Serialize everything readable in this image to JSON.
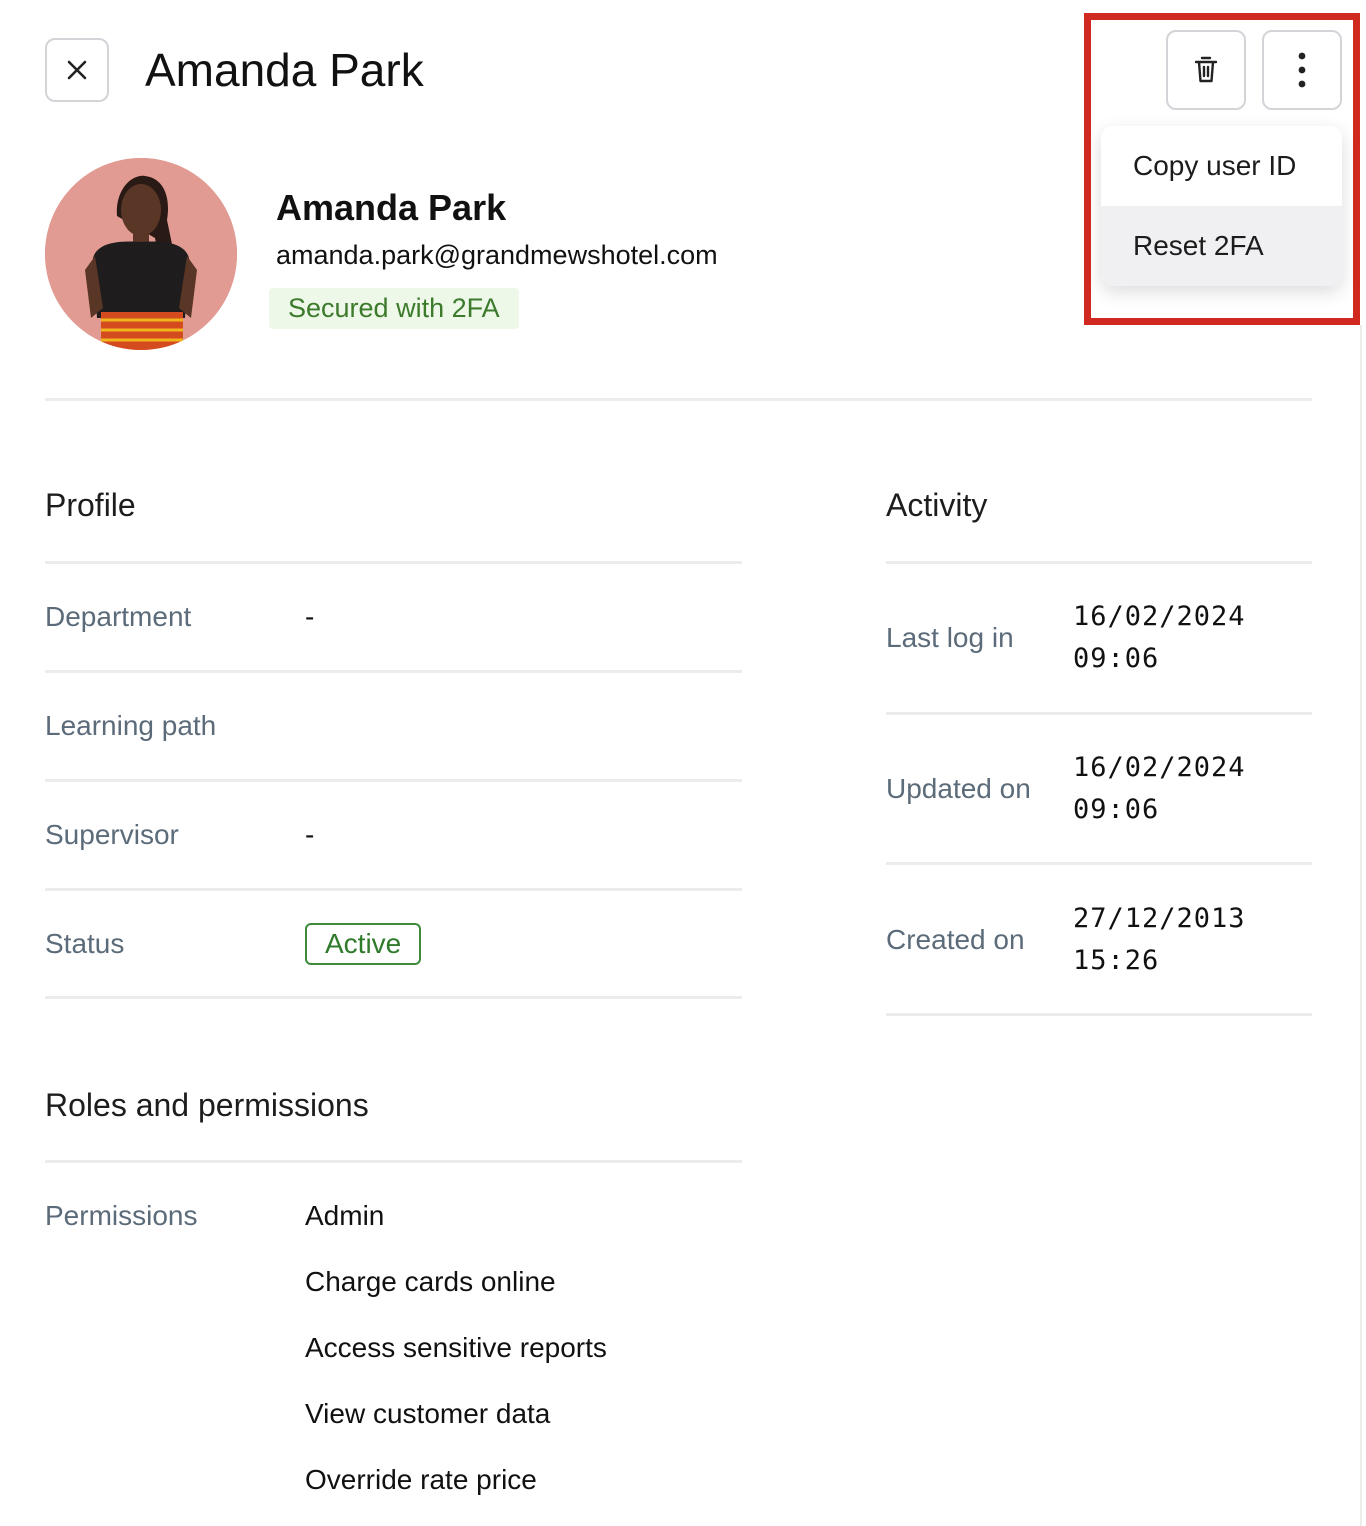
{
  "header": {
    "title": "Amanda Park"
  },
  "actions_menu": {
    "items": [
      {
        "label": "Copy user ID"
      },
      {
        "label": "Reset 2FA"
      }
    ]
  },
  "user": {
    "name": "Amanda Park",
    "email": "amanda.park@grandmewshotel.com",
    "security_badge": "Secured with 2FA"
  },
  "profile": {
    "title": "Profile",
    "rows": [
      {
        "label": "Department",
        "value": "-"
      },
      {
        "label": "Learning path",
        "value": ""
      },
      {
        "label": "Supervisor",
        "value": "-"
      },
      {
        "label": "Status",
        "value": "Active"
      }
    ]
  },
  "activity": {
    "title": "Activity",
    "rows": [
      {
        "label": "Last log in",
        "date": "16/02/2024",
        "time": "09:06"
      },
      {
        "label": "Updated on",
        "date": "16/02/2024",
        "time": "09:06"
      },
      {
        "label": "Created on",
        "date": "27/12/2013",
        "time": "15:26"
      }
    ]
  },
  "roles": {
    "title": "Roles and permissions",
    "label": "Permissions",
    "items": [
      "Admin",
      "Charge cards online",
      "Access sensitive reports",
      "View customer data",
      "Override rate price"
    ]
  },
  "colors": {
    "accent_highlight": "#d0291f",
    "status_green": "#2f7a2b",
    "badge_bg": "#eef8e8",
    "label_gray": "#5c6b7a"
  },
  "icons": {
    "close": "close-icon",
    "delete": "trash-icon",
    "more": "more-vertical-icon"
  }
}
